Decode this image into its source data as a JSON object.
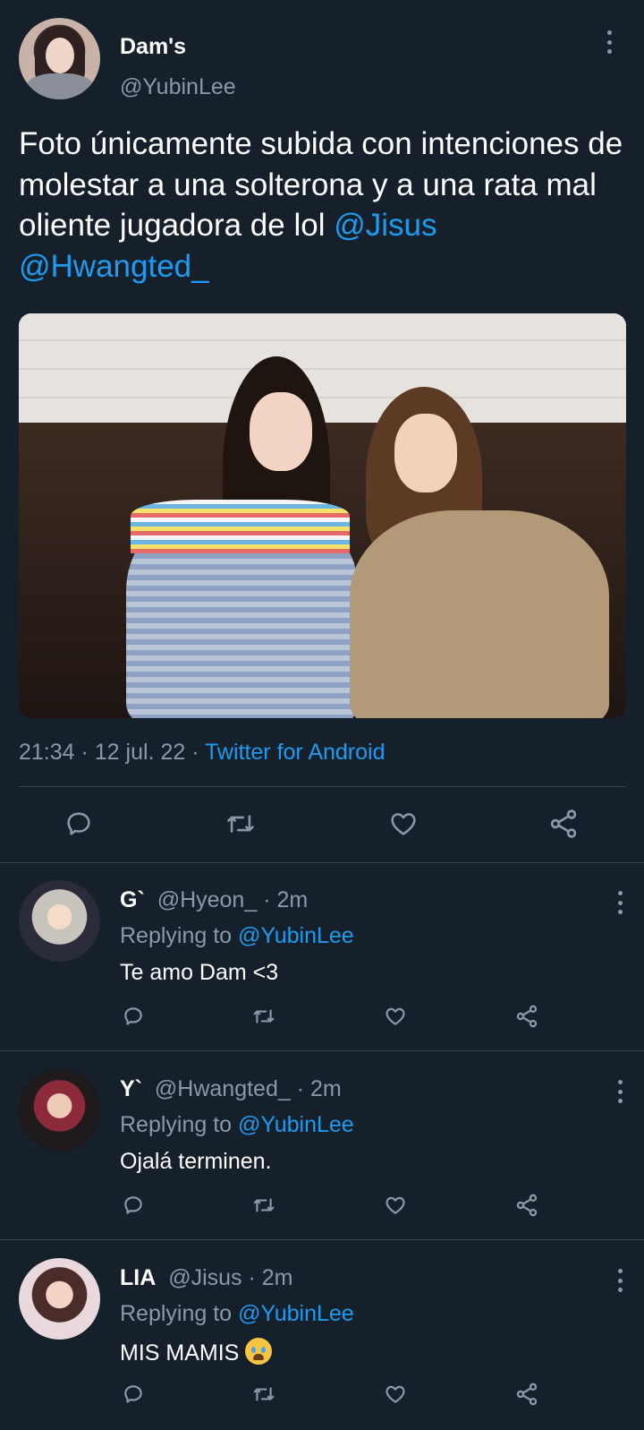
{
  "tweet": {
    "display_name": "Dam's",
    "handle": "@YubinLee",
    "text_before": "Foto únicamente subida con intenciones de molestar a una solterona y a una rata mal oliente jugadora de lol ",
    "mention_1": "@Jisus",
    "mention_2": "@Hwangted_",
    "time": "21:34",
    "sep_1": " · ",
    "date": "12 jul. 22",
    "sep_2": " · ",
    "source": "Twitter for Android",
    "icons": [
      "reply-icon",
      "retweet-icon",
      "like-icon",
      "share-icon"
    ]
  },
  "replies": [
    {
      "name": "G`",
      "handle": "@Hyeon_",
      "time": "2m",
      "replying_prefix": "Replying to ",
      "replying_handle": "@YubinLee",
      "text": "Te amo Dam <3",
      "emoji": ""
    },
    {
      "name": "Y`",
      "handle": "@Hwangted_",
      "time": "2m",
      "replying_prefix": "Replying to ",
      "replying_handle": "@YubinLee",
      "text": "Ojalá terminen.",
      "emoji": ""
    },
    {
      "name": "LIA",
      "handle": "@Jisus",
      "time": "2m",
      "replying_prefix": "Replying to ",
      "replying_handle": "@YubinLee",
      "text": "MIS MAMIS ",
      "emoji": "loudly-crying-face-emoji"
    }
  ],
  "colors": {
    "background": "#15202b",
    "accent": "#1d9bf0",
    "secondary_text": "#8b98a5",
    "divider": "#38444d"
  }
}
